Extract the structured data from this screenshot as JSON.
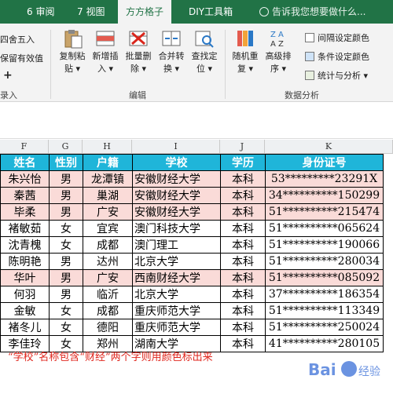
{
  "tabs": {
    "t0": "",
    "t1": "6 审阅",
    "t2": "7 视图",
    "t3": "方方格子",
    "t4": "DIY工具箱",
    "tell": "告诉我您想要做什么..."
  },
  "ribbon": {
    "left_items": [
      "四舍五入",
      "保留有效值",
      "+",
      "录入"
    ],
    "buttons": [
      {
        "l1": "复制粘",
        "l2": "贴 ▾"
      },
      {
        "l1": "新增插",
        "l2": "入 ▾"
      },
      {
        "l1": "批量删",
        "l2": "除 ▾"
      },
      {
        "l1": "合并转",
        "l2": "换 ▾"
      },
      {
        "l1": "查找定",
        "l2": "位 ▾"
      },
      {
        "l1": "随机重",
        "l2": "复 ▾"
      },
      {
        "l1": "高级排",
        "l2": "序 ▾"
      }
    ],
    "group_edit": "编辑",
    "group_analysis": "数据分析",
    "right_items": [
      "间隔设定颜色",
      "条件设定颜色",
      "统计与分析 ▾"
    ]
  },
  "columns": [
    "F",
    "G",
    "H",
    "I",
    "J",
    "K"
  ],
  "headers": [
    "姓名",
    "性别",
    "户籍",
    "学校",
    "学历",
    "身份证号"
  ],
  "rows": [
    {
      "name": "朱兴怡",
      "sex": "男",
      "hometown": "龙潭镇",
      "school": "安徽财经大学",
      "degree": "本科",
      "id": "53*********23291X",
      "highlight": true
    },
    {
      "name": "秦茜",
      "sex": "男",
      "hometown": "巢湖",
      "school": "安徽财经大学",
      "degree": "本科",
      "id": "34**********150299",
      "highlight": true
    },
    {
      "name": "毕柔",
      "sex": "男",
      "hometown": "广安",
      "school": "安徽财经大学",
      "degree": "本科",
      "id": "51**********215474",
      "highlight": true
    },
    {
      "name": "褚敏茹",
      "sex": "女",
      "hometown": "宜宾",
      "school": "澳门科技大学",
      "degree": "本科",
      "id": "51**********065624",
      "highlight": false
    },
    {
      "name": "沈青槐",
      "sex": "女",
      "hometown": "成都",
      "school": "澳门理工",
      "degree": "本科",
      "id": "51**********190066",
      "highlight": false
    },
    {
      "name": "陈明艳",
      "sex": "男",
      "hometown": "达州",
      "school": "北京大学",
      "degree": "本科",
      "id": "51**********280034",
      "highlight": false
    },
    {
      "name": "华叶",
      "sex": "男",
      "hometown": "广安",
      "school": "西南财经大学",
      "degree": "本科",
      "id": "51**********085092",
      "highlight": true
    },
    {
      "name": "何羽",
      "sex": "男",
      "hometown": "临沂",
      "school": "北京大学",
      "degree": "本科",
      "id": "37**********186354",
      "highlight": false
    },
    {
      "name": "金敏",
      "sex": "女",
      "hometown": "成都",
      "school": "重庆师范大学",
      "degree": "本科",
      "id": "51**********113349",
      "highlight": false
    },
    {
      "name": "褚冬儿",
      "sex": "女",
      "hometown": "德阳",
      "school": "重庆师范大学",
      "degree": "本科",
      "id": "51**********250024",
      "highlight": false
    },
    {
      "name": "李佳玲",
      "sex": "女",
      "hometown": "郑州",
      "school": "湖南大学",
      "degree": "本科",
      "id": "41**********280105",
      "highlight": false
    }
  ],
  "note": "“学校”名称包含“财经”两个字则用颜色标出来",
  "watermark": "Bai 经验",
  "colors": {
    "header_bg": "#1fb5d9",
    "highlight_bg": "#fadbd8",
    "note": "#e0261d",
    "tabbar": "#217346"
  }
}
